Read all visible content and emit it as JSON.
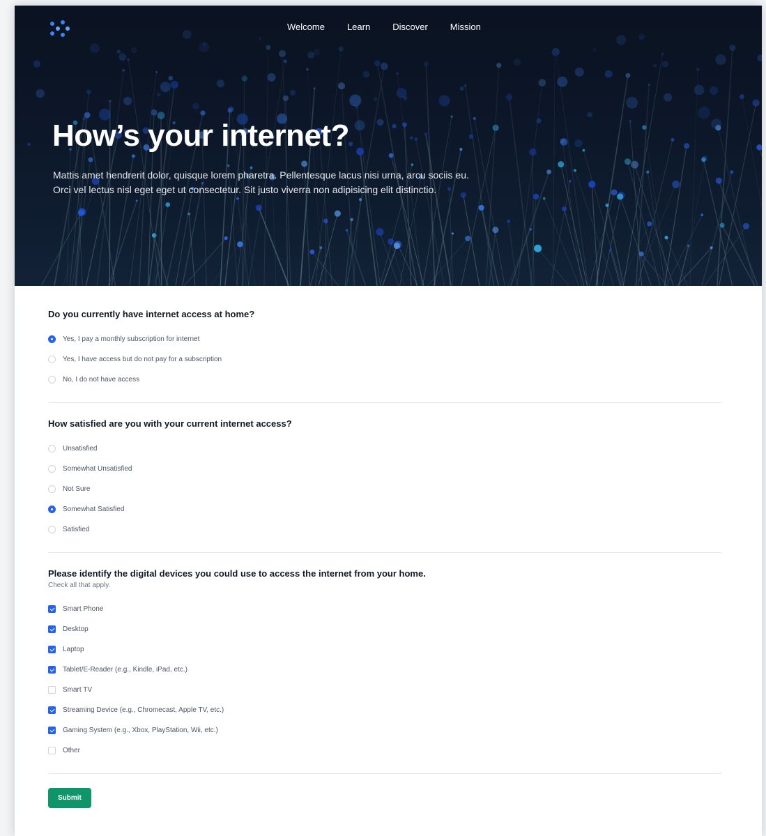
{
  "nav": {
    "logo_icon": "dots-logo-icon",
    "links": [
      "Welcome",
      "Learn",
      "Discover",
      "Mission"
    ]
  },
  "hero": {
    "title": "How’s your internet?",
    "text": "Mattis amet hendrerit dolor, quisque lorem pharetra. Pellentesque lacus nisi urna, arcu sociis eu. Orci vel lectus nisl eget eget ut consectetur. Sit justo viverra non adipisicing elit distinctio."
  },
  "questions": [
    {
      "title": "Do you currently have internet access at home?",
      "type": "radio",
      "options": [
        {
          "label": "Yes, I pay a monthly subscription for internet",
          "selected": true
        },
        {
          "label": "Yes, I have access but do not pay for a subscription",
          "selected": false
        },
        {
          "label": "No, I do not have access",
          "selected": false
        }
      ]
    },
    {
      "title": "How satisfied are you with your current internet access?",
      "type": "radio",
      "options": [
        {
          "label": "Unsatisfied",
          "selected": false
        },
        {
          "label": "Somewhat Unsatisfied",
          "selected": false
        },
        {
          "label": "Not Sure",
          "selected": false
        },
        {
          "label": "Somewhat Satisfied",
          "selected": true
        },
        {
          "label": "Satisfied",
          "selected": false
        }
      ]
    },
    {
      "title": "Please identify the digital devices you could use to access the internet from your home.",
      "subtitle": "Check all that apply.",
      "type": "checkbox",
      "options": [
        {
          "label": "Smart Phone",
          "selected": true
        },
        {
          "label": "Desktop",
          "selected": true
        },
        {
          "label": "Laptop",
          "selected": true
        },
        {
          "label": "Tablet/E-Reader (e.g., Kindle, iPad, etc.)",
          "selected": true
        },
        {
          "label": "Smart TV",
          "selected": false
        },
        {
          "label": "Streaming Device (e.g., Chromecast, Apple TV, etc.)",
          "selected": true
        },
        {
          "label": "Gaming System (e.g., Xbox, PlayStation, Wii, etc.)",
          "selected": true
        },
        {
          "label": "Other",
          "selected": false
        }
      ]
    }
  ],
  "submit_label": "Submit",
  "colors": {
    "accent": "#2563eb",
    "submit": "#10956a",
    "hero_bg": "#0d1a2e"
  }
}
